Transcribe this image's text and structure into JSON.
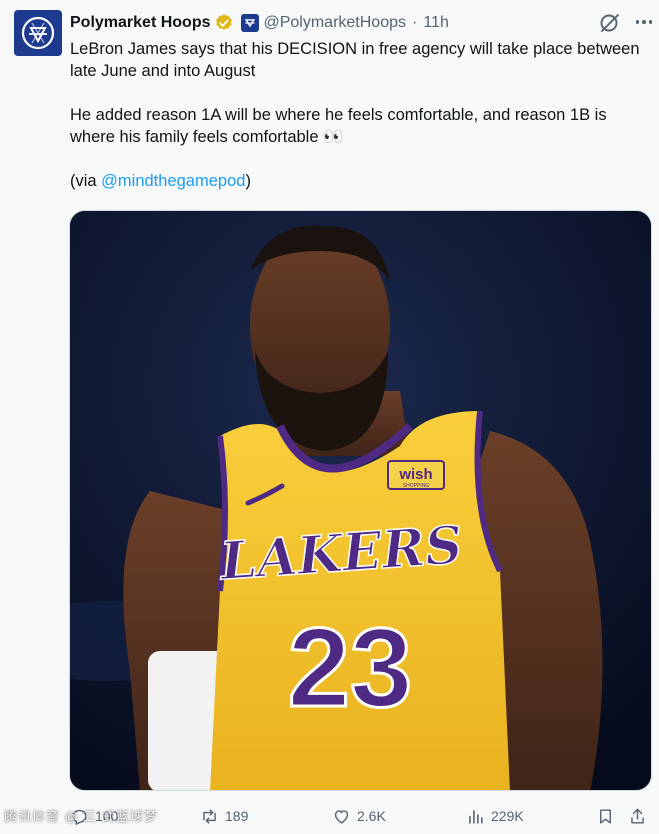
{
  "tweet": {
    "author_name": "Polymarket Hoops",
    "handle": "@PolymarketHoops",
    "separator": "·",
    "time": "11h",
    "paragraphs": [
      "LeBron James says that his DECISION in free agency will take place between late June and into August",
      "He added reason 1A will be where he feels comfortable, and reason 1B is where his family feels comfortable 👀"
    ],
    "via_prefix": "(via ",
    "via_link": "@mindthegamepod",
    "via_suffix": ")"
  },
  "media": {
    "jersey_brand": "LAKERS",
    "jersey_number": "23",
    "sponsor_patch": "wish",
    "sponsor_sub": "SHOPPING"
  },
  "actions": {
    "replies": "100",
    "reposts": "189",
    "likes": "2.6K",
    "views": "229K"
  },
  "watermark": "腾讯体育 @ 三 式篮球梦",
  "icons": {
    "verified": "verified-badge-icon",
    "affiliate": "affiliate-badge-icon",
    "grok": "grok-icon",
    "more": "more-icon",
    "reply": "reply-icon",
    "repost": "repost-icon",
    "like": "like-icon",
    "views": "views-icon",
    "bookmark": "bookmark-icon",
    "share": "share-icon"
  },
  "colors": {
    "accent": "#1d9bf0",
    "secondary_text": "#536471",
    "verified_gold": "#e2b719",
    "lakers_gold": "#f5c531",
    "lakers_purple": "#4e2a84"
  }
}
